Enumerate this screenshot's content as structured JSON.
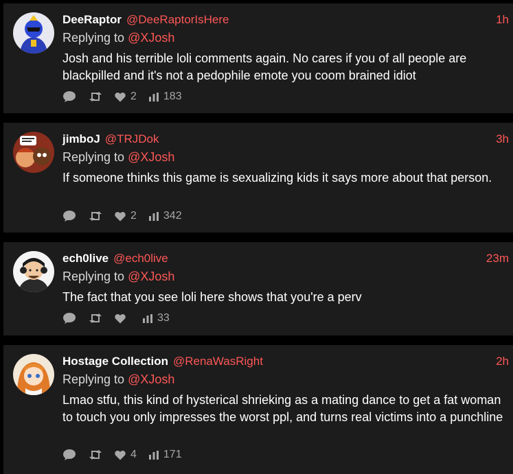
{
  "tweets": [
    {
      "name": "DeeRaptor",
      "handle": "@DeeRaptorIsHere",
      "time": "1h",
      "reply_prefix": "Replying to",
      "reply_to": "@XJosh",
      "text": "Josh and his terrible loli comments again. No cares if you of all people are blackpilled and it's not a pedophile emote you coom brained idiot",
      "likes": "2",
      "views": "183"
    },
    {
      "name": "jimboJ",
      "handle": "@TRJDok",
      "time": "3h",
      "reply_prefix": "Replying to",
      "reply_to": "@XJosh",
      "text": "If someone thinks this game is sexualizing kids it says more about that person.",
      "likes": "2",
      "views": "342"
    },
    {
      "name": "ech0live",
      "handle": "@ech0live",
      "time": "23m",
      "reply_prefix": "Replying to",
      "reply_to": "@XJosh",
      "text": "The fact that you see loli here shows that you're a perv",
      "likes": "",
      "views": "33"
    },
    {
      "name": "Hostage Collection",
      "handle": "@RenaWasRight",
      "time": "2h",
      "reply_prefix": "Replying to",
      "reply_to": "@XJosh",
      "text": "Lmao stfu, this kind of hysterical shrieking as a mating dance to get a fat woman to touch you only impresses the worst ppl, and turns real victims into a punchline",
      "likes": "4",
      "views": "171"
    }
  ],
  "colors": {
    "accent": "#ff5757",
    "card": "#1c1c1c",
    "muted": "#a8a8a8"
  },
  "icons": [
    "reply-icon",
    "retweet-icon",
    "like-icon",
    "views-icon"
  ]
}
